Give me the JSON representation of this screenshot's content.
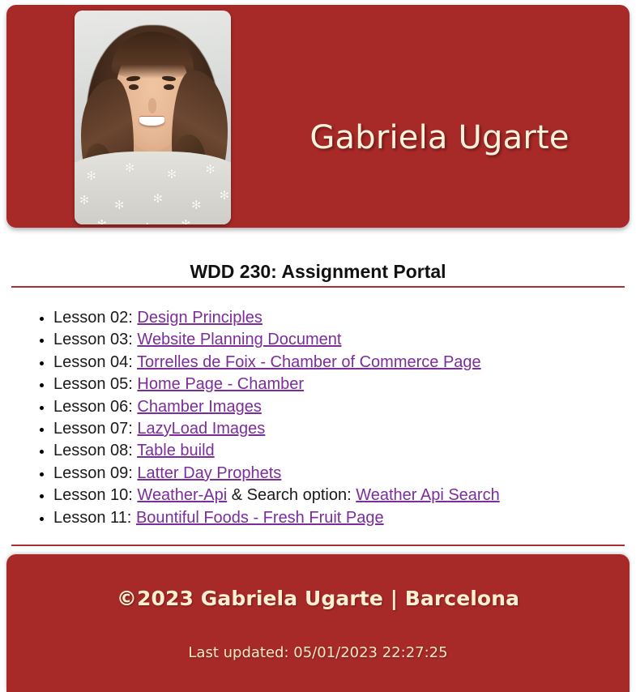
{
  "header": {
    "name": "Gabriela Ugarte",
    "photo_alt": "portrait-photo"
  },
  "main": {
    "page_title": "WDD 230: Assignment Portal",
    "lessons": [
      {
        "label": "Lesson 02: ",
        "links": [
          {
            "text": "Design Principles"
          }
        ],
        "between": "",
        "tail": ""
      },
      {
        "label": "Lesson 03: ",
        "links": [
          {
            "text": "Website Planning Document"
          }
        ],
        "between": "",
        "tail": ""
      },
      {
        "label": "Lesson 04: ",
        "links": [
          {
            "text": "Torrelles de Foix - Chamber of Commerce Page"
          }
        ],
        "between": "",
        "tail": ""
      },
      {
        "label": "Lesson 05: ",
        "links": [
          {
            "text": "Home Page - Chamber"
          }
        ],
        "between": "",
        "tail": ""
      },
      {
        "label": "Lesson 06: ",
        "links": [
          {
            "text": "Chamber Images"
          }
        ],
        "between": "",
        "tail": ""
      },
      {
        "label": "Lesson 07: ",
        "links": [
          {
            "text": "LazyLoad Images"
          }
        ],
        "between": "",
        "tail": ""
      },
      {
        "label": "Lesson 08: ",
        "links": [
          {
            "text": "Table build"
          }
        ],
        "between": "",
        "tail": ""
      },
      {
        "label": "Lesson 09: ",
        "links": [
          {
            "text": "Latter Day Prophets"
          }
        ],
        "between": "",
        "tail": ""
      },
      {
        "label": "Lesson 10: ",
        "links": [
          {
            "text": "Weather-Api"
          },
          {
            "text": "Weather Api Search"
          }
        ],
        "between": " & Search option: ",
        "tail": ""
      },
      {
        "label": "Lesson 11: ",
        "links": [
          {
            "text": "Bountiful Foods - Fresh Fruit Page"
          }
        ],
        "between": "",
        "tail": ""
      }
    ]
  },
  "footer": {
    "copyright": "©2023 Gabriela Ugarte | Barcelona",
    "last_updated": "Last updated: 05/01/2023 22:27:25"
  },
  "colors": {
    "brand_red": "#a72a28",
    "header_text": "#fdf3dd",
    "link_purple": "#7b2d9b",
    "rule_red": "#ab3130",
    "body_text": "#1a1a1a"
  }
}
